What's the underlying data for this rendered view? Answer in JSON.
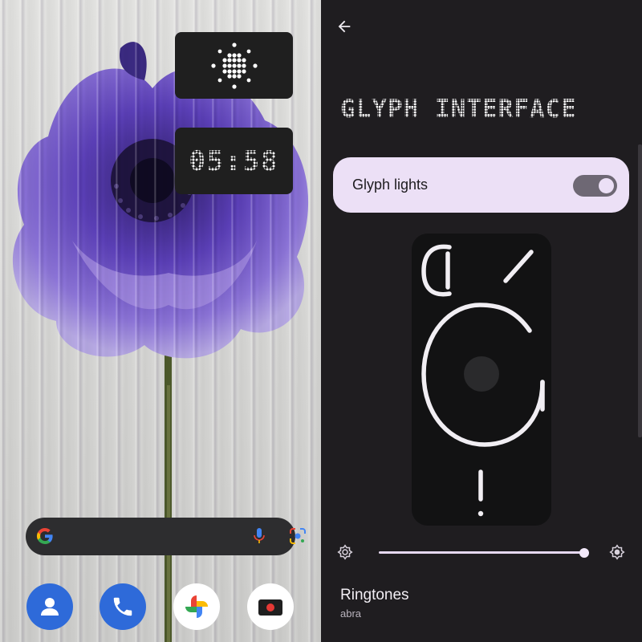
{
  "home": {
    "clock_widget": {
      "time": "05:58"
    },
    "dock": [
      {
        "icon": "contacts-icon"
      },
      {
        "icon": "phone-icon"
      },
      {
        "icon": "google-photos-icon"
      },
      {
        "icon": "camera-icon"
      }
    ],
    "search": {
      "icons": [
        "google-g-icon",
        "microphone-icon",
        "google-lens-icon"
      ]
    }
  },
  "settings": {
    "title": "GLYPH INTERFACE",
    "glyph_lights": {
      "label": "Glyph lights",
      "enabled": true
    },
    "brightness": {
      "value": 1.0
    },
    "ringtones": {
      "title": "Ringtones",
      "value": "abra"
    }
  },
  "colors": {
    "card_bg": "#ece0f6",
    "settings_bg": "#1f1d20",
    "dock_blue": "#2e6ad9",
    "flower_purple": "#5a3fb3"
  }
}
